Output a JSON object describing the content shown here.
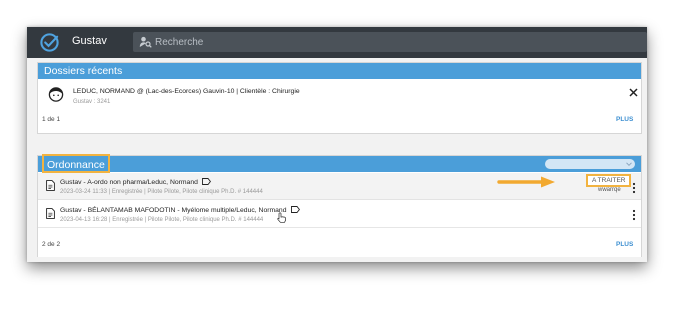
{
  "app": {
    "name": "Gustav",
    "logo_icon": "check-circle-icon"
  },
  "search": {
    "placeholder": "Recherche",
    "icon": "user-search-icon"
  },
  "recent": {
    "title": "Dossiers récents",
    "item": {
      "title": "LEDUC, NORMAND @ (Lac-des-Ecorces) Gauvin-10 | Clientèle : Chirurgie",
      "subtitle": "Gustav : 3241",
      "avatar_icon": "avatar-icon"
    },
    "pager": "1 de 1",
    "more_label": "PLUS"
  },
  "ordonnance": {
    "title": "Ordonnance",
    "rows": [
      {
        "title": "Gustav - A-ordo non pharma/Leduc, Normand",
        "subtitle": "2023-03-24 11:33 | Enregistrée | Pilote Pilote, Pilote clinique Ph.D. # 144444",
        "status": "A TRAITER",
        "assignee": "wwarrqe"
      },
      {
        "title": "Gustav - BÉLANTAMAB MAFODOTIN - Myélome multiple/Leduc, Normand",
        "subtitle": "2023-04-13 16:28 | Enregistrée | Pilote Pilote, Pilote clinique Ph.D. # 144444"
      }
    ],
    "pager": "2 de 2",
    "more_label": "PLUS"
  },
  "colors": {
    "topbar": "#33393f",
    "header": "#4b9ed9",
    "highlight": "#f2b340",
    "link": "#3d8fd1"
  }
}
